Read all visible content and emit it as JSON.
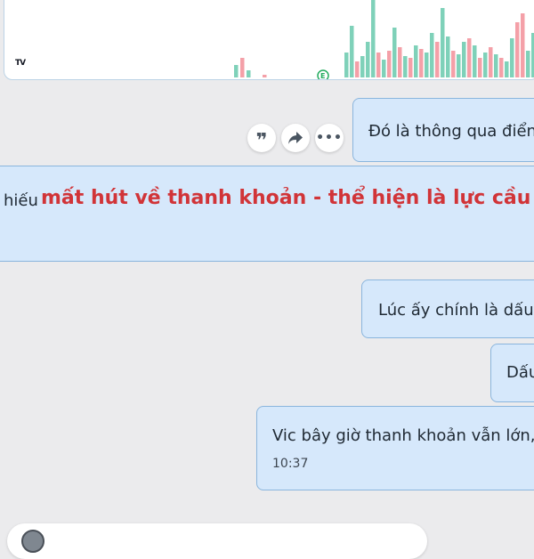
{
  "chart": {
    "logo_text": "TV",
    "colors": {
      "up": "#7fd1b9",
      "down": "#f4a0a8",
      "marker": "#22ab5e"
    },
    "marker_glyph": "E"
  },
  "messages": [
    {
      "text": "Đó là thông qua điển"
    },
    {
      "prefix": "hiếu",
      "highlight": "mất hút về thanh khoản - thể hiện là lực cầu đẩy gi"
    },
    {
      "text": "Lúc ấy chính là dấu"
    },
    {
      "text": "Dấu"
    },
    {
      "text": "Vic bây giờ thanh khoản vẫn lớn,",
      "time": "10:37"
    }
  ],
  "actions": {
    "quote_glyph": "❞",
    "more_glyph": "•••"
  },
  "composer": {}
}
